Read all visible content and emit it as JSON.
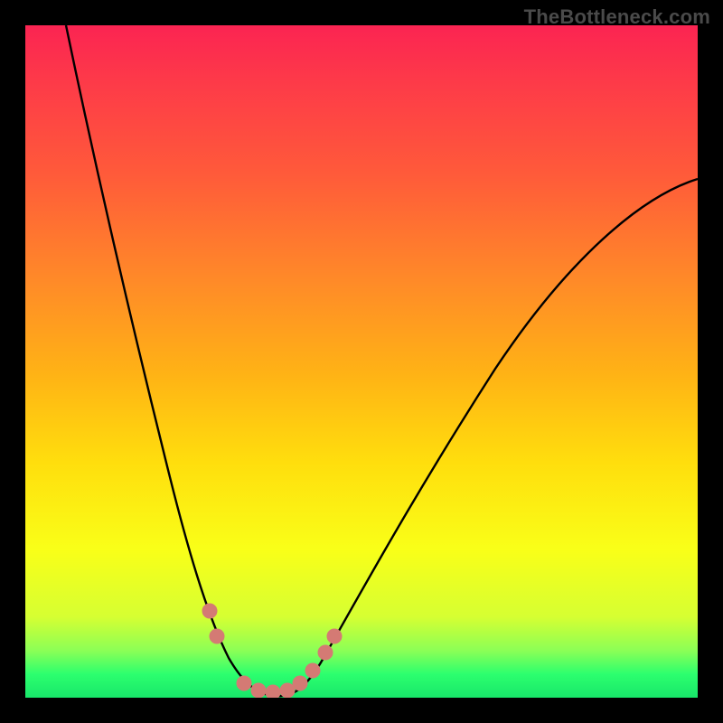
{
  "watermark": "TheBottleneck.com",
  "chart_data": {
    "type": "line",
    "title": "",
    "xlabel": "",
    "ylabel": "",
    "xlim": [
      0,
      100
    ],
    "ylim": [
      0,
      100
    ],
    "grid": false,
    "note": "V-shaped bottleneck curve on vertical red→green gradient. X is an arbitrary component-ratio axis; Y is bottleneck percentage (0 at bottom, ~100 at top). Values are read off the plotted curve against the gradient; no axes or tick labels are shown.",
    "series": [
      {
        "name": "bottleneck-curve",
        "x": [
          6,
          10,
          14,
          18,
          22,
          26,
          28,
          30,
          32,
          34,
          36,
          38,
          40,
          42,
          44,
          48,
          55,
          65,
          75,
          85,
          95,
          100
        ],
        "y": [
          100,
          86,
          72,
          58,
          44,
          28,
          20,
          12,
          6,
          2,
          0,
          0,
          0,
          2,
          6,
          14,
          26,
          42,
          55,
          65,
          73,
          77
        ]
      }
    ],
    "markers": {
      "name": "highlight-dots",
      "color": "#d47a74",
      "points": [
        {
          "x": 27,
          "y": 14
        },
        {
          "x": 28,
          "y": 10
        },
        {
          "x": 33,
          "y": 1
        },
        {
          "x": 35,
          "y": 0
        },
        {
          "x": 37,
          "y": 0
        },
        {
          "x": 39,
          "y": 0
        },
        {
          "x": 41,
          "y": 1
        },
        {
          "x": 43,
          "y": 4
        },
        {
          "x": 45,
          "y": 8
        },
        {
          "x": 46,
          "y": 11
        }
      ]
    },
    "left_endpoint_reaches_top": true,
    "right_endpoint_y_percent_of_height": 77
  }
}
